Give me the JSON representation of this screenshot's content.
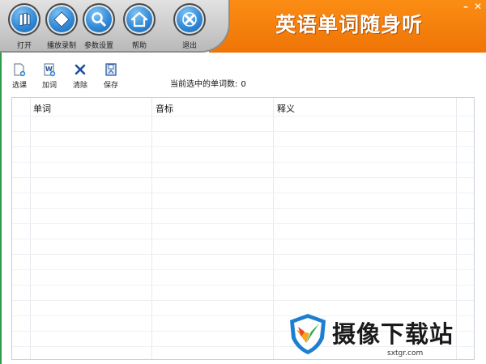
{
  "app": {
    "title": "英语单词随身听"
  },
  "window_controls": {
    "minimize": "–",
    "close": "✕"
  },
  "main_toolbar": {
    "items": [
      {
        "label": "打开",
        "icon": "book-icon"
      },
      {
        "label": "播放录制",
        "icon": "play-diamond-icon"
      },
      {
        "label": "参数设置",
        "icon": "magnifier-icon"
      },
      {
        "label": "帮助",
        "icon": "home-icon"
      },
      {
        "label": "退出",
        "icon": "exit-cross-icon"
      }
    ]
  },
  "sub_toolbar": {
    "items": [
      {
        "label": "选课",
        "icon": "document-add-icon"
      },
      {
        "label": "加词",
        "icon": "word-add-icon"
      },
      {
        "label": "清除",
        "icon": "delete-x-icon"
      },
      {
        "label": "保存",
        "icon": "save-icon"
      }
    ],
    "status_label": "当前选中的单词数:",
    "status_count": "0"
  },
  "word_table": {
    "columns": [
      "单词",
      "音标",
      "释义"
    ],
    "rows": []
  },
  "watermark": {
    "text": "摄像下载站",
    "url": "sxtgr.com"
  },
  "colors": {
    "accent_orange": "#f58010",
    "toolbar_blue": "#2f86d3",
    "panel_gray": "#c9c9c9"
  }
}
